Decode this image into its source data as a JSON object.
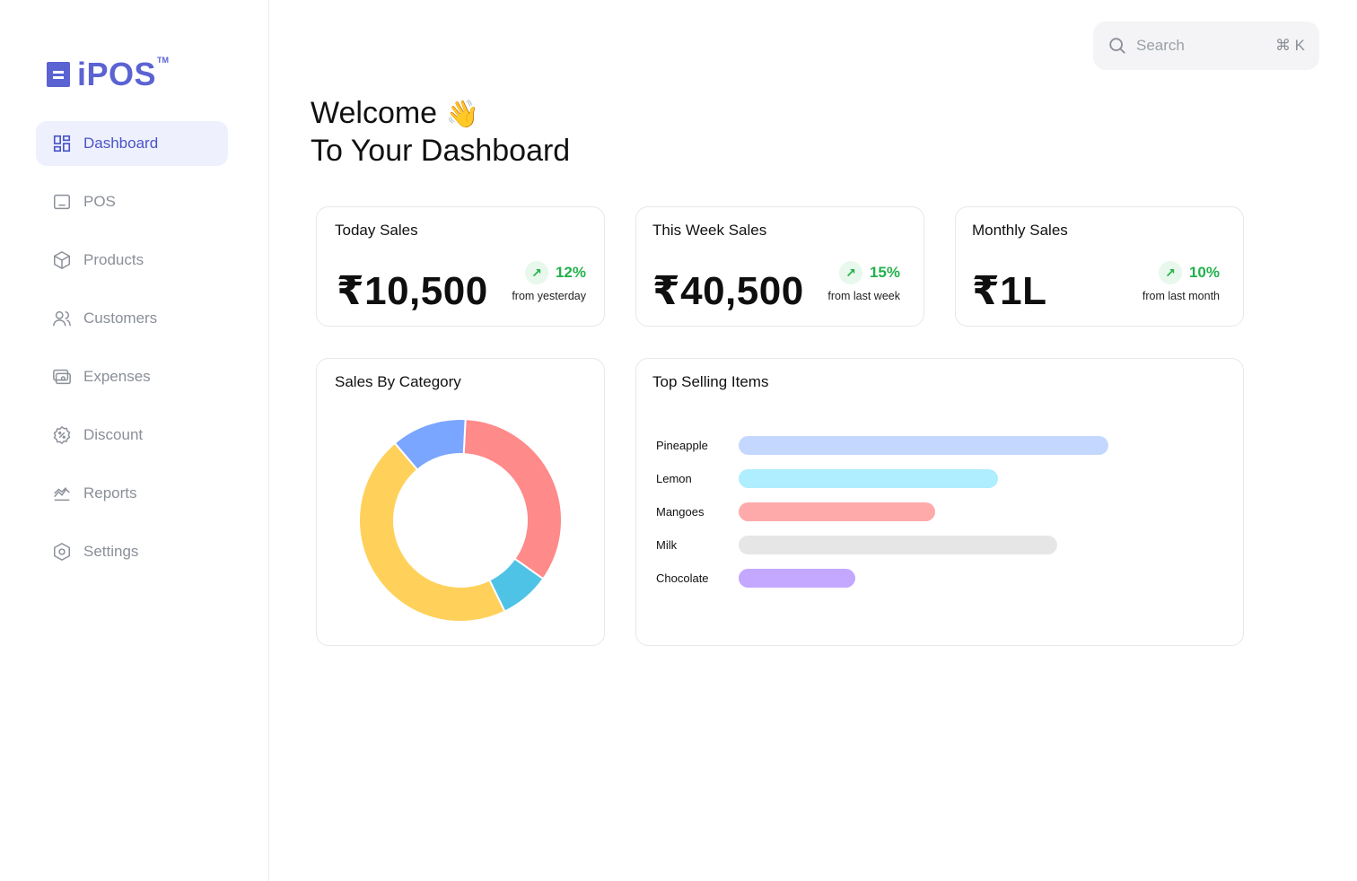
{
  "brand": {
    "name": "iPOS",
    "tm": "TM",
    "accent": "#5b63d3"
  },
  "sidebar": {
    "items": [
      {
        "label": "Dashboard",
        "icon": "dashboard-grid-icon",
        "active": true
      },
      {
        "label": "POS",
        "icon": "monitor-icon"
      },
      {
        "label": "Products",
        "icon": "box-icon"
      },
      {
        "label": "Customers",
        "icon": "users-icon"
      },
      {
        "label": "Expenses",
        "icon": "wallet-icon"
      },
      {
        "label": "Discount",
        "icon": "discount-badge-icon"
      },
      {
        "label": "Reports",
        "icon": "chart-line-icon"
      },
      {
        "label": "Settings",
        "icon": "gear-hex-icon"
      }
    ]
  },
  "search": {
    "placeholder": "Search",
    "shortcut": "⌘ K"
  },
  "welcome": {
    "line1": "Welcome",
    "emoji": "👋",
    "line2": "To Your Dashboard"
  },
  "stats": [
    {
      "title": "Today Sales",
      "value": "₹10,500",
      "trend": "12%",
      "sub": "from yesterday",
      "direction": "up"
    },
    {
      "title": "This Week Sales",
      "value": "₹40,500",
      "trend": "15%",
      "sub": "from last week",
      "direction": "up"
    },
    {
      "title": "Monthly Sales",
      "value": "₹1L",
      "trend": "10%",
      "sub": "from last month",
      "direction": "up"
    }
  ],
  "category_card": {
    "title": "Sales By Category"
  },
  "top_card": {
    "title": "Top Selling Items"
  },
  "chart_data": [
    {
      "type": "pie",
      "title": "Sales By Category",
      "donut": true,
      "slices": [
        {
          "value": 0.34,
          "color": "#ff8a8a"
        },
        {
          "value": 0.08,
          "color": "#4fc3e6"
        },
        {
          "value": 0.46,
          "color": "#ffd15a"
        },
        {
          "value": 0.12,
          "color": "#7aa6ff"
        }
      ]
    },
    {
      "type": "bar",
      "orientation": "horizontal",
      "title": "Top Selling Items",
      "categories": [
        "Pineapple",
        "Lemon",
        "Mangoes",
        "Milk",
        "Chocolate"
      ],
      "values": [
        412,
        289,
        219,
        355,
        130
      ],
      "colors": [
        "#c4d8ff",
        "#aeeeff",
        "#ffaaaa",
        "#e6e6e6",
        "#c4a7ff"
      ]
    }
  ]
}
